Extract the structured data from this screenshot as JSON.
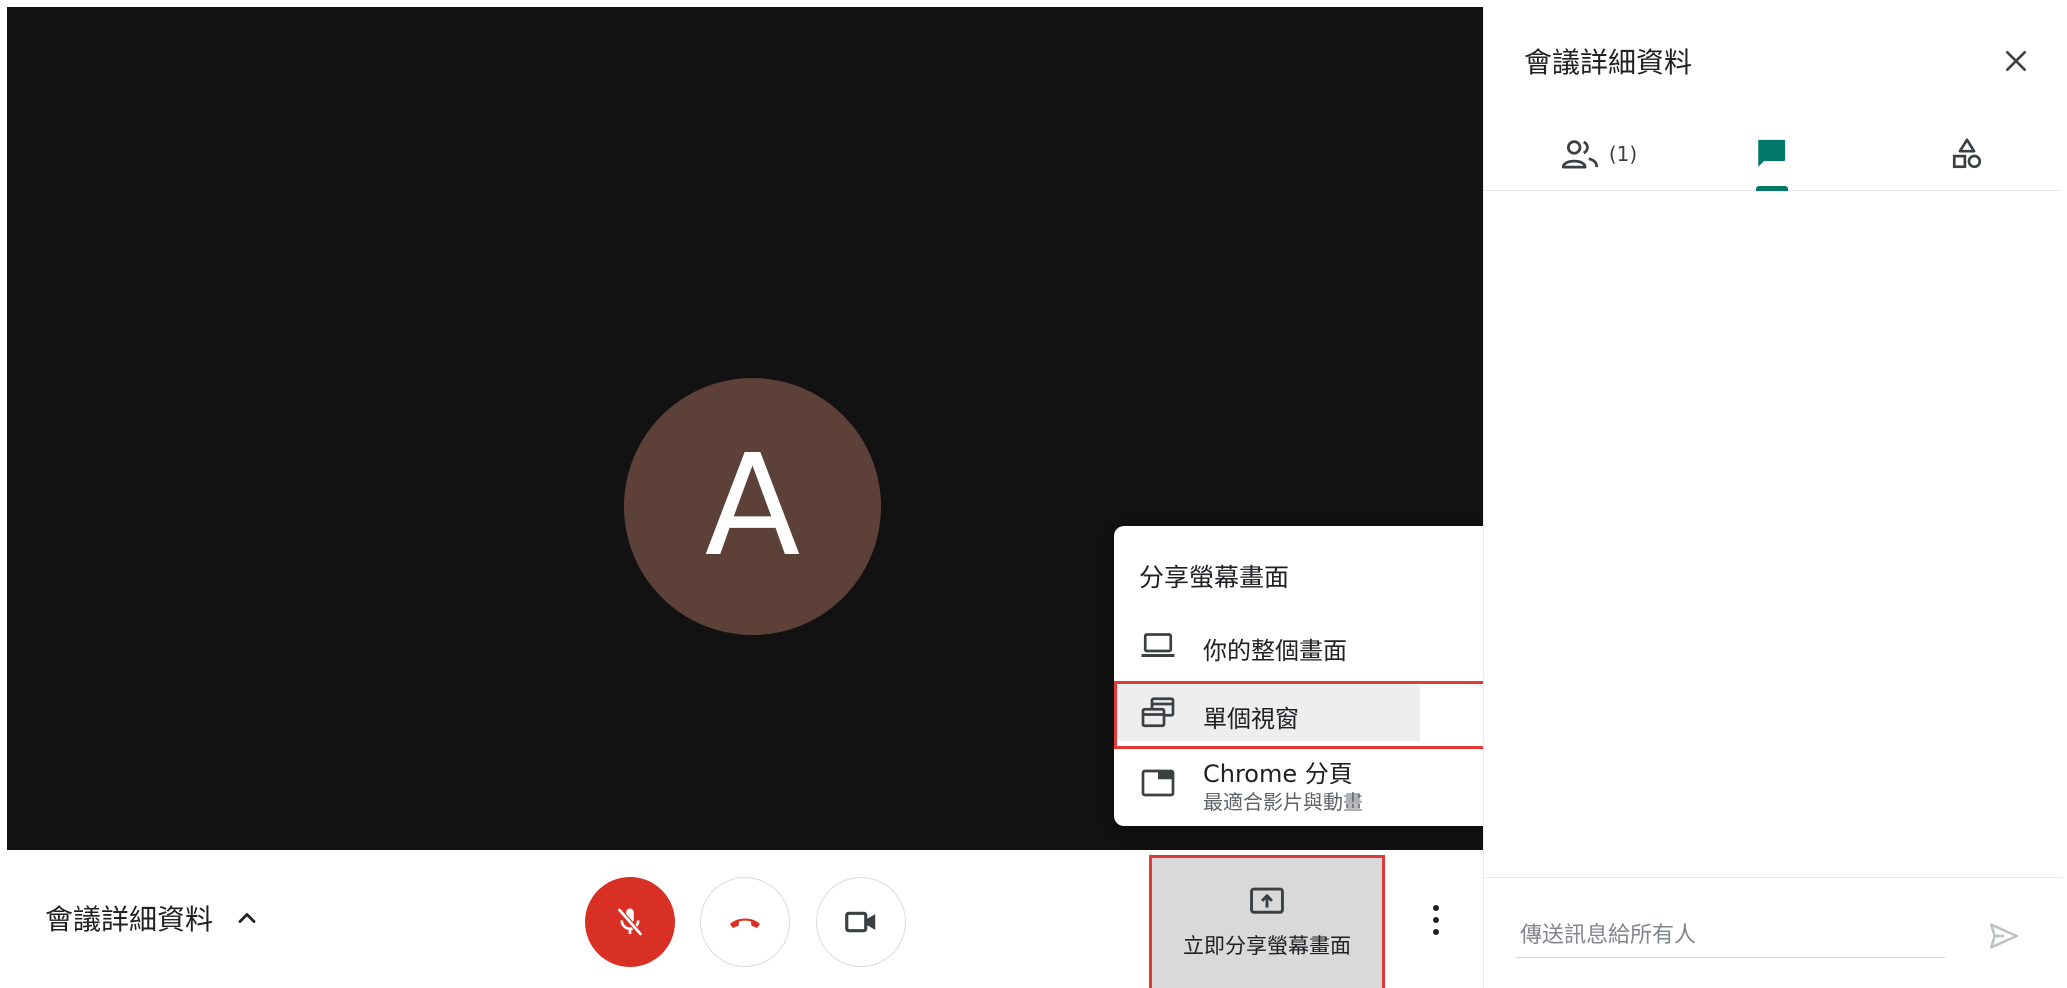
{
  "stage": {
    "avatar_initial": "A",
    "avatar_color": "#5d4037",
    "background": "#121212"
  },
  "bottom_bar": {
    "meeting_details_label": "會議詳細資料",
    "present_now_label": "立即分享螢幕畫面",
    "mic_state": "muted",
    "mic_button_color": "#d93025",
    "hangup_icon_color": "#d93025"
  },
  "share_menu": {
    "title": "分享螢幕畫面",
    "items": [
      {
        "label": "你的整個畫面",
        "icon": "laptop-icon"
      },
      {
        "label": "單個視窗",
        "icon": "window-stack-icon",
        "highlighted": true
      },
      {
        "label": "Chrome 分頁",
        "sublabel": "最適合影片與動畫",
        "icon": "tab-icon"
      }
    ]
  },
  "side_panel": {
    "title": "會議詳細資料",
    "tabs": {
      "people_count": "(1)",
      "active_tab": "chat"
    },
    "chat": {
      "input_placeholder": "傳送訊息給所有人"
    },
    "accent_color": "#00796b"
  }
}
